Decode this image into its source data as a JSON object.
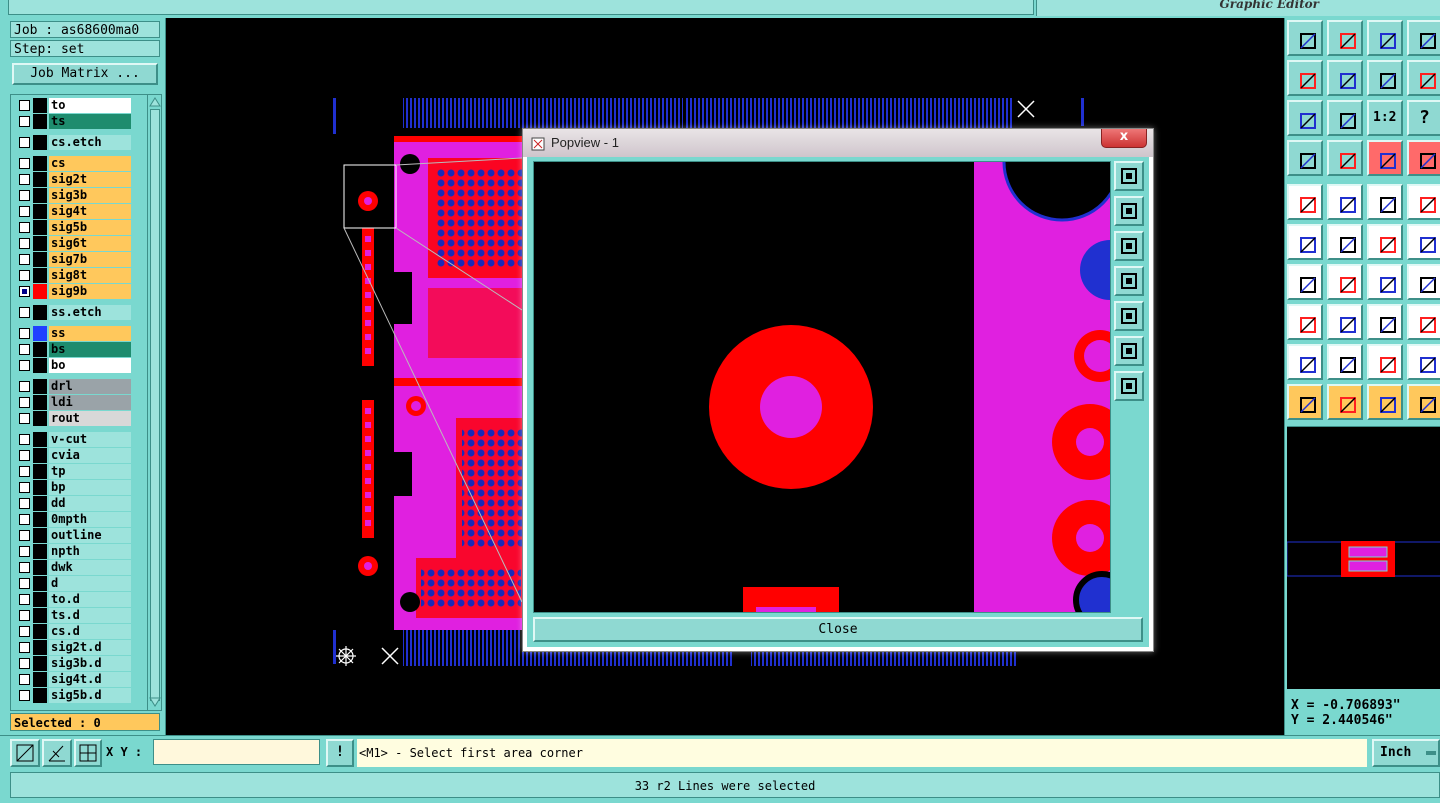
{
  "app": {
    "subtitle": "Graphic Editor"
  },
  "job": {
    "job_label": "Job : as68600ma0",
    "step_label": "Step: set",
    "matrix_button": "Job Matrix ..."
  },
  "layers": [
    {
      "name": "to",
      "color": "#ffffff",
      "checked": false
    },
    {
      "name": "ts",
      "color": "#1e8c6e",
      "checked": false
    },
    {
      "name": "cs.etch",
      "color": "#9de3dc",
      "checked": false
    },
    {
      "name": "cs",
      "color": "#ffc85c",
      "checked": false
    },
    {
      "name": "sig2t",
      "color": "#ffc85c",
      "checked": false
    },
    {
      "name": "sig3b",
      "color": "#ffc85c",
      "checked": false
    },
    {
      "name": "sig4t",
      "color": "#ffc85c",
      "checked": false
    },
    {
      "name": "sig5b",
      "color": "#ffc85c",
      "checked": false
    },
    {
      "name": "sig6t",
      "color": "#ffc85c",
      "checked": false
    },
    {
      "name": "sig7b",
      "color": "#ffc85c",
      "checked": false
    },
    {
      "name": "sig8t",
      "color": "#ffc85c",
      "checked": false
    },
    {
      "name": "sig9b",
      "color": "#ffc85c",
      "checked": true,
      "swatch": "#ff0000"
    },
    {
      "name": "ss.etch",
      "color": "#9de3dc",
      "checked": false
    },
    {
      "name": "ss",
      "color": "#ffc85c",
      "checked": false,
      "swatch": "#2040ff"
    },
    {
      "name": "bs",
      "color": "#1e8c6e",
      "checked": false
    },
    {
      "name": "bo",
      "color": "#ffffff",
      "checked": false
    },
    {
      "name": "drl",
      "color": "#9aa3a8",
      "checked": false
    },
    {
      "name": "ldi",
      "color": "#9aa3a8",
      "checked": false
    },
    {
      "name": "rout",
      "color": "#d8d8d8",
      "checked": false
    },
    {
      "name": "v-cut",
      "color": "#9de3dc",
      "checked": false
    },
    {
      "name": "cvia",
      "color": "#9de3dc",
      "checked": false
    },
    {
      "name": "tp",
      "color": "#9de3dc",
      "checked": false
    },
    {
      "name": "bp",
      "color": "#9de3dc",
      "checked": false
    },
    {
      "name": "dd",
      "color": "#9de3dc",
      "checked": false
    },
    {
      "name": "0mpth",
      "color": "#9de3dc",
      "checked": false
    },
    {
      "name": "outline",
      "color": "#9de3dc",
      "checked": false
    },
    {
      "name": "npth",
      "color": "#9de3dc",
      "checked": false
    },
    {
      "name": "dwk",
      "color": "#9de3dc",
      "checked": false
    },
    {
      "name": "d",
      "color": "#9de3dc",
      "checked": false
    },
    {
      "name": "to.d",
      "color": "#9de3dc",
      "checked": false
    },
    {
      "name": "ts.d",
      "color": "#9de3dc",
      "checked": false
    },
    {
      "name": "cs.d",
      "color": "#9de3dc",
      "checked": false
    },
    {
      "name": "sig2t.d",
      "color": "#9de3dc",
      "checked": false
    },
    {
      "name": "sig3b.d",
      "color": "#9de3dc",
      "checked": false
    },
    {
      "name": "sig4t.d",
      "color": "#9de3dc",
      "checked": false
    },
    {
      "name": "sig5b.d",
      "color": "#9de3dc",
      "checked": false
    }
  ],
  "selected_label": "Selected : 0",
  "popview": {
    "title": "Popview - 1",
    "close_x": "x",
    "close_button": "Close"
  },
  "coords": {
    "x": "X = -0.706893\"",
    "y": "Y = 2.440546\""
  },
  "command": {
    "xy_label": "X Y :",
    "xy_value": "",
    "exclaim": "!",
    "prompt": "<M1> - Select first area corner",
    "unit": "Inch"
  },
  "status": "33 r2 Lines were selected",
  "toolbar": {
    "one_to_two": "1:2",
    "question": "?"
  }
}
